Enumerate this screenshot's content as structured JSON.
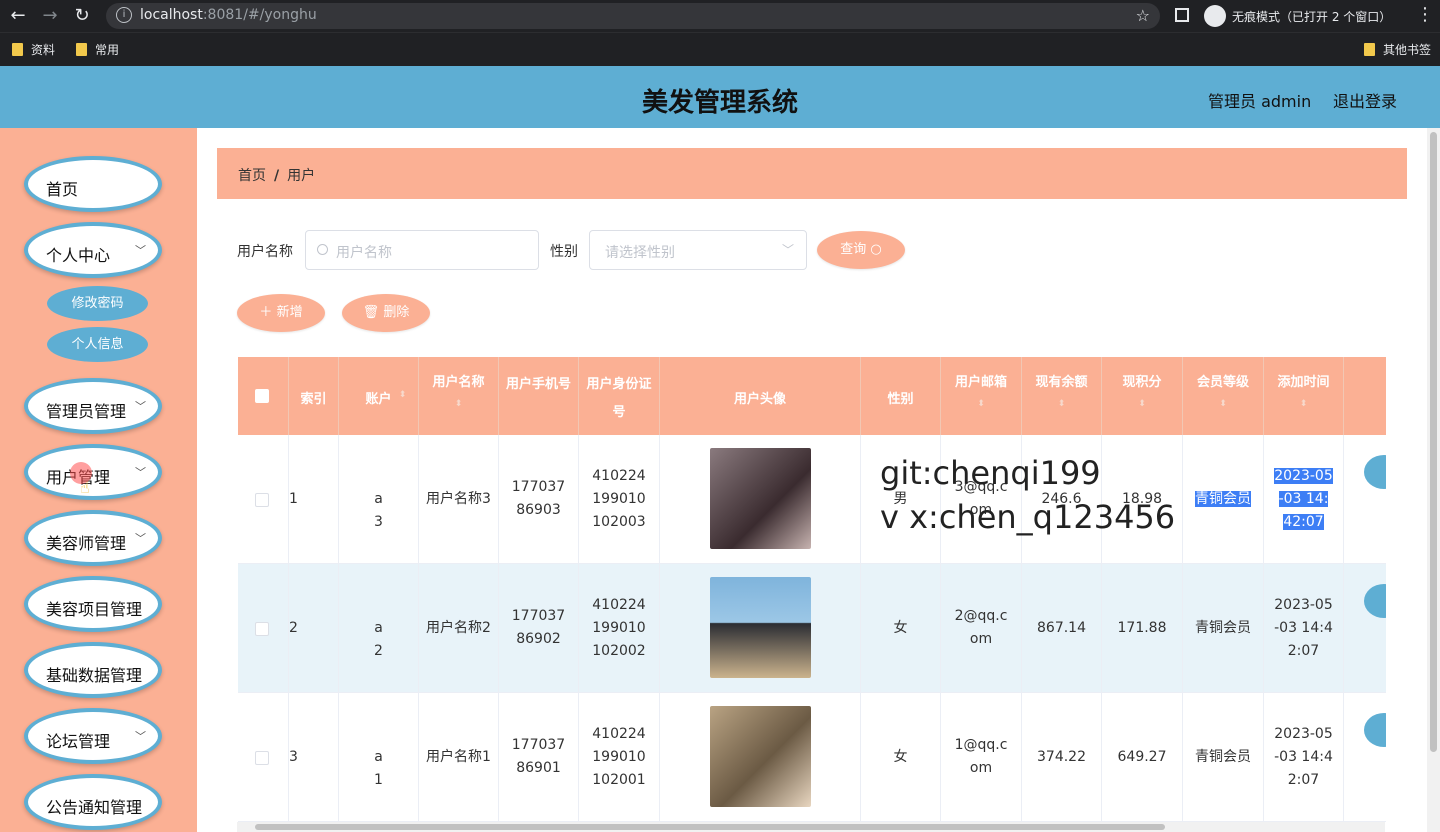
{
  "browser": {
    "url_host": "localhost",
    "url_rest": ":8081/#/yonghu",
    "incognito_text": "无痕模式（已打开 2 个窗口）",
    "bookmarks": [
      "资料",
      "常用"
    ],
    "other_bookmarks": "其他书签"
  },
  "header": {
    "title": "美发管理系统",
    "admin_label": "管理员 admin",
    "logout": "退出登录"
  },
  "sidebar": {
    "items": [
      {
        "label": "首页"
      },
      {
        "label": "个人中心"
      },
      {
        "label": "管理员管理"
      },
      {
        "label": "用户管理"
      },
      {
        "label": "美容师管理"
      },
      {
        "label": "美容项目管理"
      },
      {
        "label": "基础数据管理"
      },
      {
        "label": "论坛管理"
      },
      {
        "label": "公告通知管理"
      }
    ],
    "sub_items": [
      "修改密码",
      "个人信息"
    ]
  },
  "breadcrumb": {
    "home": "首页",
    "sep": "/",
    "current": "用户"
  },
  "search": {
    "name_label": "用户名称",
    "name_placeholder": "用户名称",
    "gender_label": "性别",
    "gender_placeholder": "请选择性别",
    "query_button": "查询"
  },
  "actions": {
    "add": "新增",
    "delete": "删除"
  },
  "table": {
    "columns": [
      "索引",
      "账户",
      "用户名称",
      "用户手机号",
      "用户身份证号",
      "用户头像",
      "性别",
      "用户邮箱",
      "现有余额",
      "现积分",
      "会员等级",
      "添加时间"
    ],
    "rows": [
      {
        "index": "1",
        "account": "a3",
        "name": "用户名称3",
        "phone": "17703786903",
        "idcard": "410224199010102003",
        "gender": "男",
        "email": "3@qq.com",
        "balance": "246.6",
        "points": "18.98",
        "level": "青铜会员",
        "time": "2023-05-03 14:42:07"
      },
      {
        "index": "2",
        "account": "a2",
        "name": "用户名称2",
        "phone": "17703786902",
        "idcard": "410224199010102002",
        "gender": "女",
        "email": "2@qq.com",
        "balance": "867.14",
        "points": "171.88",
        "level": "青铜会员",
        "time": "2023-05-03 14:42:07"
      },
      {
        "index": "3",
        "account": "a1",
        "name": "用户名称1",
        "phone": "17703786901",
        "idcard": "410224199010102001",
        "gender": "女",
        "email": "1@qq.com",
        "balance": "374.22",
        "points": "649.27",
        "level": "青铜会员",
        "time": "2023-05-03 14:42:07"
      }
    ]
  },
  "watermark": {
    "line1": "git:chenqi199",
    "line2": "v x:chen_q123456"
  },
  "colors": {
    "header": "#5eaed3",
    "accent": "#fbb094",
    "selection": "#3d7ef5"
  }
}
